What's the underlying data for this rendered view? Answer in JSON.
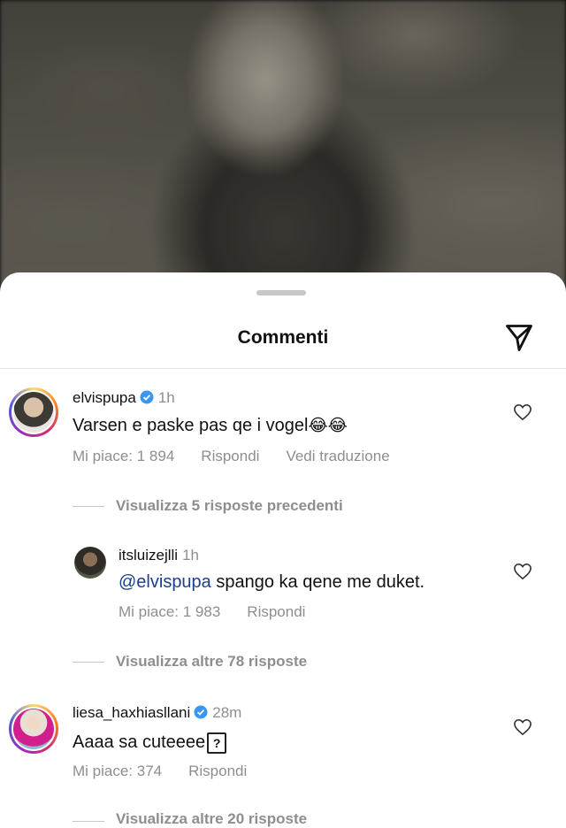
{
  "sheet": {
    "title": "Commenti",
    "send_icon": "paper-plane-icon"
  },
  "comments": [
    {
      "username": "elvispupa",
      "verified": true,
      "time": "1h",
      "text_main": "Varsen e paske pas qe i vogel",
      "text_emoji": "😂😂",
      "likes": "Mi piace: 1 894",
      "reply_label": "Rispondi",
      "translate_label": "Vedi traduzione",
      "view_replies": "Visualizza 5 risposte precedenti"
    },
    {
      "username": "itsluizejlli",
      "verified": false,
      "time": "1h",
      "mention": "@elvispupa",
      "text_main": " spango ka qene me duket.",
      "likes": "Mi piace: 1 983",
      "reply_label": "Rispondi",
      "view_replies": "Visualizza altre 78 risposte"
    },
    {
      "username": "liesa_haxhiasllani",
      "verified": true,
      "time": "28m",
      "text_main": "Aaaa sa cuteeee",
      "text_box": "?",
      "likes": "Mi piace: 374",
      "reply_label": "Rispondi",
      "view_replies": "Visualizza altre 20 risposte"
    }
  ],
  "colors": {
    "verified": "#3897f0",
    "meta": "#8e8e8e",
    "mention": "#1b3f8f"
  }
}
